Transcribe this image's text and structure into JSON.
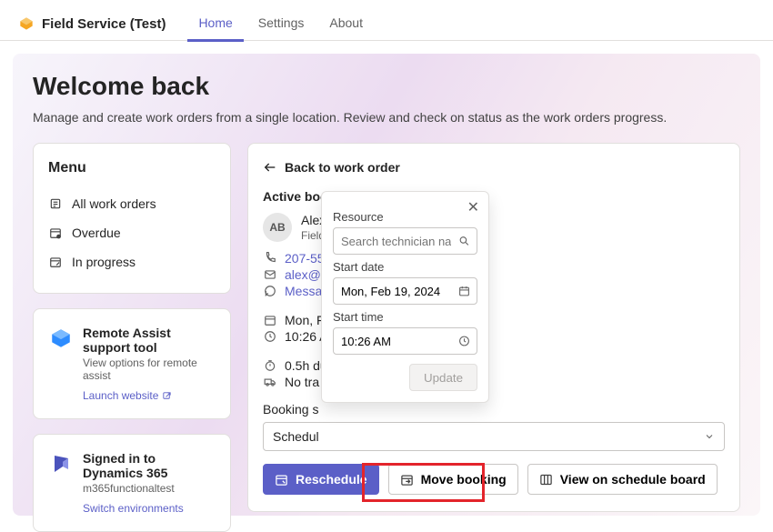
{
  "header": {
    "app_title": "Field Service (Test)",
    "tabs": [
      {
        "label": "Home",
        "active": true
      },
      {
        "label": "Settings",
        "active": false
      },
      {
        "label": "About",
        "active": false
      }
    ]
  },
  "welcome": {
    "title": "Welcome back",
    "subtitle": "Manage and create work orders from a single location. Review and check on status as the work orders progress."
  },
  "menu": {
    "title": "Menu",
    "items": [
      {
        "label": "All work orders"
      },
      {
        "label": "Overdue"
      },
      {
        "label": "In progress"
      }
    ]
  },
  "tiles": {
    "remote": {
      "title": "Remote Assist support tool",
      "subtitle": "View options for remote assist",
      "link_label": "Launch website"
    },
    "dynamics": {
      "title": "Signed in to Dynamics 365",
      "subtitle": "m365functionaltest",
      "link_label": "Switch environments"
    }
  },
  "main": {
    "back_label": "Back to work order",
    "section_title": "Active booking",
    "person": {
      "initials": "AB",
      "name": "Alex Baker",
      "role": "Field"
    },
    "phone": "207-55",
    "email": "alex@c",
    "message": "Messa",
    "date_line": "Mon, F",
    "time_line": "10:26 A",
    "duration": "0.5h du",
    "travel": "No tra",
    "booking_status_label": "Booking s",
    "status_value": "Schedul"
  },
  "buttons": {
    "reschedule": "Reschedule",
    "move_booking": "Move booking",
    "view_board": "View on schedule board"
  },
  "popover": {
    "resource_label": "Resource",
    "resource_placeholder": "Search technician name",
    "start_date_label": "Start date",
    "start_date_value": "Mon, Feb 19, 2024",
    "start_time_label": "Start time",
    "start_time_value": "10:26 AM",
    "update": "Update"
  }
}
